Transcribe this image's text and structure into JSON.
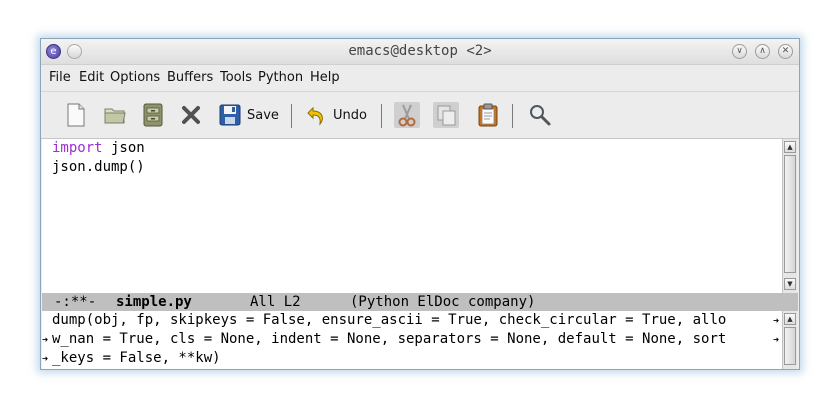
{
  "window": {
    "title": "emacs@desktop <2>"
  },
  "menubar": {
    "items": [
      "File",
      "Edit",
      "Options",
      "Buffers",
      "Tools",
      "Python",
      "Help"
    ]
  },
  "toolbar": {
    "save_label": "Save",
    "undo_label": "Undo",
    "icons": [
      "new-file-icon",
      "open-folder-icon",
      "open-directory-icon",
      "close-buffer-icon",
      "save-icon",
      "undo-icon",
      "cut-icon",
      "copy-icon",
      "paste-icon",
      "search-icon"
    ]
  },
  "editor": {
    "lines": [
      {
        "keyword": "import",
        "rest": " json"
      },
      {
        "keyword": "",
        "rest": "json.dump()"
      }
    ]
  },
  "modeline": {
    "status": "-:**-",
    "buffer": "simple.py",
    "position": "All L2",
    "modes": "(Python ElDoc company)"
  },
  "echo": {
    "lines": [
      "dump(obj, fp, skipkeys = False, ensure_ascii = True, check_circular = True, allo",
      "w_nan = True, cls = None, indent = None, separators = None, default = None, sort",
      "_keys = False, **kw)"
    ]
  },
  "colors": {
    "keyword": "#9d2fd1",
    "modeline_bg": "#bfbfbf",
    "window_border": "#8aa6bd"
  }
}
